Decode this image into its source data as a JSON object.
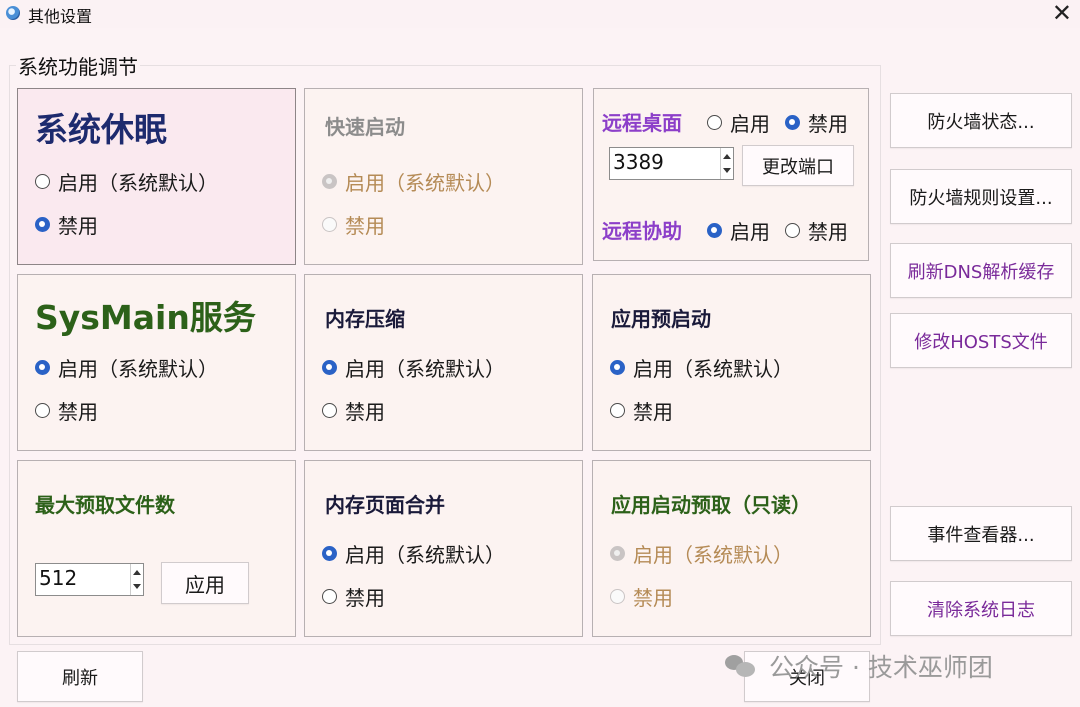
{
  "window": {
    "title": "其他设置"
  },
  "group": {
    "title": "系统功能调节"
  },
  "panels": {
    "sleep": {
      "title": "系统休眠",
      "opt_enable": "启用（系统默认）",
      "opt_disable": "禁用"
    },
    "fast_startup": {
      "title": "快速启动",
      "opt_enable": "启用（系统默认）",
      "opt_disable": "禁用"
    },
    "remote": {
      "desktop_label": "远程桌面",
      "desktop_enable": "启用",
      "desktop_disable": "禁用",
      "port_value": "3389",
      "change_port": "更改端口",
      "assist_label": "远程协助",
      "assist_enable": "启用",
      "assist_disable": "禁用"
    },
    "sysmain": {
      "title": "SysMain服务",
      "opt_enable": "启用（系统默认）",
      "opt_disable": "禁用"
    },
    "mem_compress": {
      "title": "内存压缩",
      "opt_enable": "启用（系统默认）",
      "opt_disable": "禁用"
    },
    "app_prelaunch": {
      "title": "应用预启动",
      "opt_enable": "启用（系统默认）",
      "opt_disable": "禁用"
    },
    "max_prefetch": {
      "title": "最大预取文件数",
      "value": "512",
      "apply": "应用"
    },
    "page_combine": {
      "title": "内存页面合并",
      "opt_enable": "启用（系统默认）",
      "opt_disable": "禁用"
    },
    "app_launch_prefetch": {
      "title": "应用启动预取（只读）",
      "opt_enable": "启用（系统默认）",
      "opt_disable": "禁用"
    }
  },
  "side_buttons": {
    "firewall_status": "防火墙状态...",
    "firewall_rules": "防火墙规则设置...",
    "flush_dns": "刷新DNS解析缓存",
    "edit_hosts": "修改HOSTS文件",
    "event_viewer": "事件查看器...",
    "clear_logs": "清除系统日志"
  },
  "bottom": {
    "refresh": "刷新",
    "close": "关闭"
  },
  "watermark": {
    "text": "公众号 · 技术巫师团"
  },
  "colors": {
    "accent": "#2a62c6",
    "navy": "#1d2a6e",
    "green": "#2c6119",
    "purple": "#8c3fc9"
  }
}
